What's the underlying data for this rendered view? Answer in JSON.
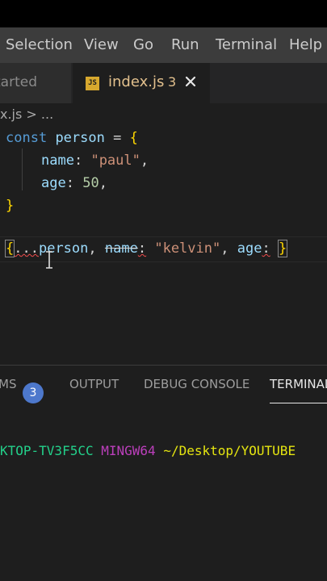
{
  "menu": [
    "Selection",
    "View",
    "Go",
    "Run",
    "Terminal",
    "Help"
  ],
  "tabs": {
    "inactive_label": "tarted",
    "active": {
      "file_icon": "JS",
      "filename": "index.js",
      "problem_count": "3",
      "close_icon": "close-icon"
    }
  },
  "breadcrumb": "x.js > ...",
  "code": {
    "line1": {
      "keyword": "const",
      "name": "person",
      "op": "=",
      "open": "{"
    },
    "line2": {
      "key": "name",
      "colon": ":",
      "value": "\"paul\"",
      "comma": ","
    },
    "line3": {
      "key": "age",
      "colon": ":",
      "value": "50",
      "comma": ","
    },
    "line4": {
      "close": "}"
    },
    "line6": {
      "open": "{",
      "spread": "...",
      "ident": "person",
      "sep1": ",",
      "key1": "name",
      "colon1": ":",
      "str1": "\"kelvin\"",
      "sep2": ",",
      "key2": "age",
      "colon2": ":",
      "close": "}"
    }
  },
  "panel": {
    "tabs": [
      {
        "label": "MS",
        "badge": "3"
      },
      {
        "label": "OUTPUT"
      },
      {
        "label": "DEBUG CONSOLE"
      },
      {
        "label": "TERMINAL"
      }
    ],
    "terminal": {
      "host": "KTOP-TV3F5CC",
      "system": "MINGW64",
      "path": "~/Desktop/YOUTUBE"
    }
  },
  "colors": {
    "editor_bg": "#1e1e1e",
    "menubar_bg": "#3c3c3c",
    "keyword": "#569cd6",
    "string": "#ce9178",
    "number": "#b5cea8",
    "badge": "#4d78cc",
    "terminal_host": "#23d18b",
    "terminal_system": "#bc3fbc",
    "terminal_path": "#e5e510"
  }
}
